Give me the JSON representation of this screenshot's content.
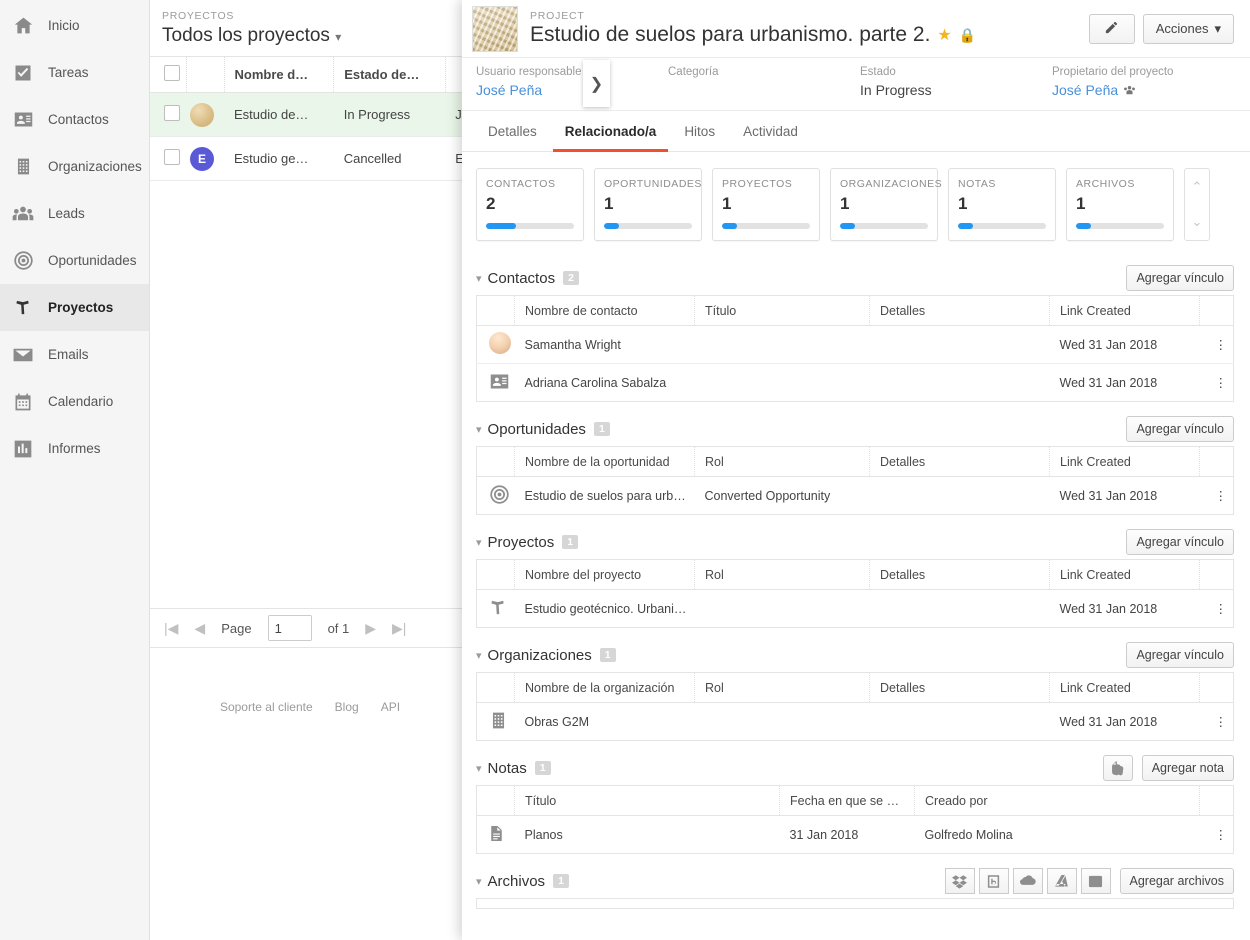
{
  "sidebar": {
    "items": [
      {
        "label": "Inicio",
        "icon": "home-icon",
        "active": false
      },
      {
        "label": "Tareas",
        "icon": "check-square-icon",
        "active": false
      },
      {
        "label": "Contactos",
        "icon": "contact-card-icon",
        "active": false
      },
      {
        "label": "Organizaciones",
        "icon": "building-icon",
        "active": false
      },
      {
        "label": "Leads",
        "icon": "people-icon",
        "active": false
      },
      {
        "label": "Oportunidades",
        "icon": "target-icon",
        "active": false
      },
      {
        "label": "Proyectos",
        "icon": "hammer-icon",
        "active": true
      },
      {
        "label": "Emails",
        "icon": "envelope-icon",
        "active": false
      },
      {
        "label": "Calendario",
        "icon": "calendar-icon",
        "active": false
      },
      {
        "label": "Informes",
        "icon": "bar-chart-icon",
        "active": false
      }
    ]
  },
  "list_panel": {
    "eyebrow": "PROYECTOS",
    "title": "Todos los proyectos",
    "title_caret": "▾",
    "columns": [
      "Nombre d…",
      "Estado de…"
    ],
    "rows": [
      {
        "name": "Estudio de…",
        "status": "In Progress",
        "owner": "J",
        "avatar_type": "photo",
        "avatar_letter": "",
        "selected": true
      },
      {
        "name": "Estudio ge…",
        "status": "Cancelled",
        "owner": "E",
        "avatar_type": "letter",
        "avatar_letter": "E",
        "selected": false
      }
    ],
    "expand_arrow": "❯",
    "pagination": {
      "first": "|◀",
      "prev": "◀",
      "page_label": "Page",
      "page_value": "1",
      "of_label": "of 1",
      "next": "▶",
      "last": "▶|"
    },
    "footer": [
      "Soporte al cliente",
      "Blog",
      "API"
    ]
  },
  "detail": {
    "eyebrow": "PROJECT",
    "title": "Estudio de suelos para urbanismo. parte 2.",
    "star_icon": "star-icon",
    "lock_icon": "lock-icon",
    "edit_icon": "pencil-icon",
    "actions_label": "Acciones",
    "actions_caret": "▾",
    "meta": [
      {
        "label": "Usuario responsable",
        "value": "José Peña",
        "link": true
      },
      {
        "label": "Categoría",
        "value": "",
        "link": false
      },
      {
        "label": "Estado",
        "value": "In Progress",
        "link": false
      },
      {
        "label": "Propietario del proyecto",
        "value": "José Peña",
        "link": true
      }
    ],
    "tabs": [
      {
        "label": "Detalles",
        "active": false
      },
      {
        "label": "Relacionado/a",
        "active": true
      },
      {
        "label": "Hitos",
        "active": false
      },
      {
        "label": "Actividad",
        "active": false
      }
    ],
    "cards": [
      {
        "label": "CONTACTOS",
        "value": "2",
        "progress": 34
      },
      {
        "label": "OPORTUNIDADES",
        "value": "1",
        "progress": 17
      },
      {
        "label": "PROYECTOS",
        "value": "1",
        "progress": 17
      },
      {
        "label": "ORGANIZACIONES",
        "value": "1",
        "progress": 17
      },
      {
        "label": "NOTAS",
        "value": "1",
        "progress": 17
      },
      {
        "label": "ARCHIVOS",
        "value": "1",
        "progress": 17
      }
    ],
    "card_scroll": {
      "up": "⌃",
      "down": "⌄"
    },
    "sections": [
      {
        "key": "contactos",
        "title": "Contactos",
        "count": "2",
        "caret": "▾",
        "action_label": "Agregar vínculo",
        "columns": [
          "Nombre de contacto",
          "Título",
          "Detalles",
          "Link Created"
        ],
        "rows": [
          {
            "icon": "person-photo-icon",
            "name": "Samantha Wright",
            "col2": "",
            "col3": "",
            "date": "Wed 31 Jan 2018",
            "menu": "⋮"
          },
          {
            "icon": "contact-card-icon",
            "name": "Adriana Carolina Sabalza",
            "col2": "",
            "col3": "",
            "date": "Wed 31 Jan 2018",
            "menu": "⋮"
          }
        ]
      },
      {
        "key": "oportunidades",
        "title": "Oportunidades",
        "count": "1",
        "caret": "▾",
        "action_label": "Agregar vínculo",
        "columns": [
          "Nombre de la oportunidad",
          "Rol",
          "Detalles",
          "Link Created"
        ],
        "rows": [
          {
            "icon": "target-icon",
            "name": "Estudio de suelos para urb…",
            "col2": "Converted Opportunity",
            "col3": "",
            "date": "Wed 31 Jan 2018",
            "menu": "⋮"
          }
        ]
      },
      {
        "key": "proyectos",
        "title": "Proyectos",
        "count": "1",
        "caret": "▾",
        "action_label": "Agregar vínculo",
        "columns": [
          "Nombre del proyecto",
          "Rol",
          "Detalles",
          "Link Created"
        ],
        "rows": [
          {
            "icon": "hammer-icon",
            "name": "Estudio geotécnico. Urbani…",
            "col2": "",
            "col3": "",
            "date": "Wed 31 Jan 2018",
            "menu": "⋮"
          }
        ]
      },
      {
        "key": "organizaciones",
        "title": "Organizaciones",
        "count": "1",
        "caret": "▾",
        "action_label": "Agregar vínculo",
        "columns": [
          "Nombre de la organización",
          "Rol",
          "Detalles",
          "Link Created"
        ],
        "rows": [
          {
            "icon": "building-icon",
            "name": "Obras G2M",
            "col2": "",
            "col3": "",
            "date": "Wed 31 Jan 2018",
            "menu": "⋮"
          }
        ]
      },
      {
        "key": "notas",
        "title": "Notas",
        "count": "1",
        "caret": "▾",
        "action_label": "Agregar nota",
        "extra_icon": "evernote-icon",
        "columns": [
          "Título",
          "Fecha en que se …",
          "Creado por"
        ],
        "rows": [
          {
            "icon": "note-icon",
            "name": "Planos",
            "col2": "31 Jan 2018",
            "col3": "Golfredo Molina",
            "date": "",
            "menu": "⋮"
          }
        ]
      },
      {
        "key": "archivos",
        "title": "Archivos",
        "count": "1",
        "caret": "▾",
        "action_label": "Agregar archivos",
        "cloud_icons": [
          "dropbox-icon",
          "box-icon",
          "onedrive-icon",
          "googledrive-icon",
          "pandadoc-icon"
        ],
        "columns": [],
        "rows": []
      }
    ]
  },
  "colors": {
    "accent_blue": "#2196f3",
    "link_blue": "#4a90d9",
    "tab_active": "#f1502f",
    "selected_row": "#e9f6e9",
    "star": "#f5b521"
  }
}
